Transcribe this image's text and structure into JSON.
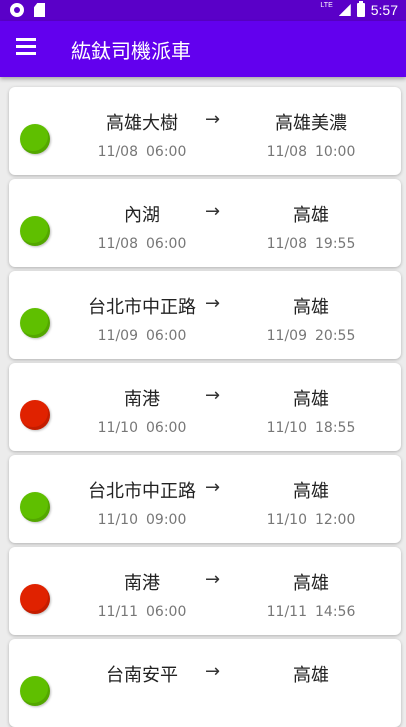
{
  "status_bar": {
    "time": "5:57",
    "network": "LTE"
  },
  "app_bar": {
    "title": "紘鈦司機派車",
    "menu_icon": "menu-icon"
  },
  "colors": {
    "green": "#5fbf00",
    "red": "#e02200",
    "primary": "#6200ee"
  },
  "trips": [
    {
      "status": "green",
      "from": "高雄大樹",
      "to": "高雄美濃",
      "arrow": "→",
      "depart_date": "11/08",
      "depart_time": "06:00",
      "arrive_date": "11/08",
      "arrive_time": "10:00"
    },
    {
      "status": "green",
      "from": "內湖",
      "to": "高雄",
      "arrow": "→",
      "depart_date": "11/08",
      "depart_time": "06:00",
      "arrive_date": "11/08",
      "arrive_time": "19:55"
    },
    {
      "status": "green",
      "from": "台北市中正路",
      "to": "高雄",
      "arrow": "→",
      "depart_date": "11/09",
      "depart_time": "06:00",
      "arrive_date": "11/09",
      "arrive_time": "20:55"
    },
    {
      "status": "red",
      "from": "南港",
      "to": "高雄",
      "arrow": "→",
      "depart_date": "11/10",
      "depart_time": "06:00",
      "arrive_date": "11/10",
      "arrive_time": "18:55"
    },
    {
      "status": "green",
      "from": "台北市中正路",
      "to": "高雄",
      "arrow": "→",
      "depart_date": "11/10",
      "depart_time": "09:00",
      "arrive_date": "11/10",
      "arrive_time": "12:00"
    },
    {
      "status": "red",
      "from": "南港",
      "to": "高雄",
      "arrow": "→",
      "depart_date": "11/11",
      "depart_time": "06:00",
      "arrive_date": "11/11",
      "arrive_time": "14:56"
    },
    {
      "status": "green",
      "from": "台南安平",
      "to": "高雄",
      "arrow": "→",
      "depart_date": "",
      "depart_time": "",
      "arrive_date": "",
      "arrive_time": ""
    }
  ]
}
